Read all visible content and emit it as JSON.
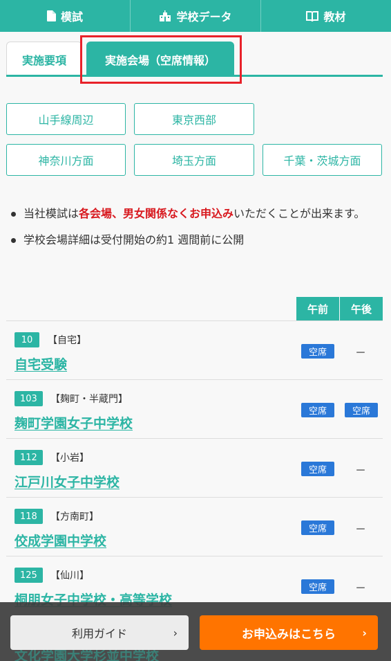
{
  "nav": {
    "items": [
      {
        "label": "模試",
        "icon": "file-icon"
      },
      {
        "label": "学校データ",
        "icon": "school-icon"
      },
      {
        "label": "教材",
        "icon": "book-icon"
      }
    ]
  },
  "tabs": {
    "inactive": "実施要項",
    "active": "実施会場（空席情報）"
  },
  "regions": [
    "山手線周辺",
    "東京西部",
    "神奈川方面",
    "埼玉方面",
    "千葉・茨城方面"
  ],
  "notes": {
    "n1_a": "当社模試は",
    "n1_red": "各会場、男女関係なくお申込み",
    "n1_b": "いただくことが出来ます。",
    "n2": "学校会場詳細は受付開始の約1 週間前に公開"
  },
  "table": {
    "am": "午前",
    "pm": "午後",
    "rows": [
      {
        "code": "10",
        "area": "【自宅】",
        "name": "自宅受験",
        "am": "空席",
        "pm": "－"
      },
      {
        "code": "103",
        "area": "【麹町・半蔵門】",
        "name": "麹町学園女子中学校",
        "am": "空席",
        "pm": "空席"
      },
      {
        "code": "112",
        "area": "【小岩】",
        "name": "江戸川女子中学校",
        "am": "空席",
        "pm": "－"
      },
      {
        "code": "118",
        "area": "【方南町】",
        "name": "佼成学園中学校",
        "am": "空席",
        "pm": "－"
      },
      {
        "code": "125",
        "area": "【仙川】",
        "name": "桐朋女子中学校・高等学校",
        "am": "空席",
        "pm": "－"
      }
    ],
    "partial_name": "文化学園大学杉並中学校"
  },
  "footer": {
    "guide": "利用ガイド",
    "apply": "お申込みはこちら",
    "chevron": "›"
  },
  "colors": {
    "primary": "#2cb5a4",
    "seat": "#2a78d8",
    "apply": "#ff7400",
    "highlight": "#e8222a"
  }
}
